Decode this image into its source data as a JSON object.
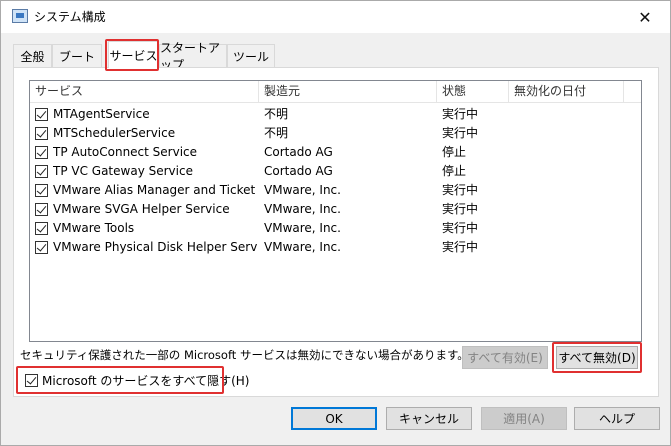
{
  "window": {
    "title": "システム構成",
    "close_glyph": "✕"
  },
  "tabs": [
    {
      "label": "全般"
    },
    {
      "label": "ブート"
    },
    {
      "label": "サービス"
    },
    {
      "label": "スタートアップ"
    },
    {
      "label": "ツール"
    }
  ],
  "active_tab": "サービス",
  "columns": {
    "service": "サービス",
    "maker": "製造元",
    "status": "状態",
    "disabled_date": "無効化の日付"
  },
  "services": [
    {
      "name": "MTAgentService",
      "maker": "不明",
      "status": "実行中",
      "disabled_date": "",
      "checked": true
    },
    {
      "name": "MTSchedulerService",
      "maker": "不明",
      "status": "実行中",
      "disabled_date": "",
      "checked": true
    },
    {
      "name": "TP AutoConnect Service",
      "maker": "Cortado AG",
      "status": "停止",
      "disabled_date": "",
      "checked": true
    },
    {
      "name": "TP VC Gateway Service",
      "maker": "Cortado AG",
      "status": "停止",
      "disabled_date": "",
      "checked": true
    },
    {
      "name": "VMware Alias Manager and Ticket Se...",
      "maker": "VMware, Inc.",
      "status": "実行中",
      "disabled_date": "",
      "checked": true
    },
    {
      "name": "VMware SVGA Helper Service",
      "maker": "VMware, Inc.",
      "status": "実行中",
      "disabled_date": "",
      "checked": true
    },
    {
      "name": "VMware Tools",
      "maker": "VMware, Inc.",
      "status": "実行中",
      "disabled_date": "",
      "checked": true
    },
    {
      "name": "VMware Physical Disk Helper Service",
      "maker": "VMware, Inc.",
      "status": "実行中",
      "disabled_date": "",
      "checked": true
    }
  ],
  "notice": "セキュリティ保護された一部の Microsoft サービスは無効にできない場合があります。",
  "buttons": {
    "enable_all": "すべて有効(E)",
    "disable_all": "すべて無効(D)",
    "ok": "OK",
    "cancel": "キャンセル",
    "apply": "適用(A)",
    "help": "ヘルプ"
  },
  "hide_ms": {
    "label": "Microsoft のサービスをすべて隠す(H)",
    "checked": true
  },
  "colors": {
    "highlight": "#e03030",
    "focus": "#0078d7"
  }
}
